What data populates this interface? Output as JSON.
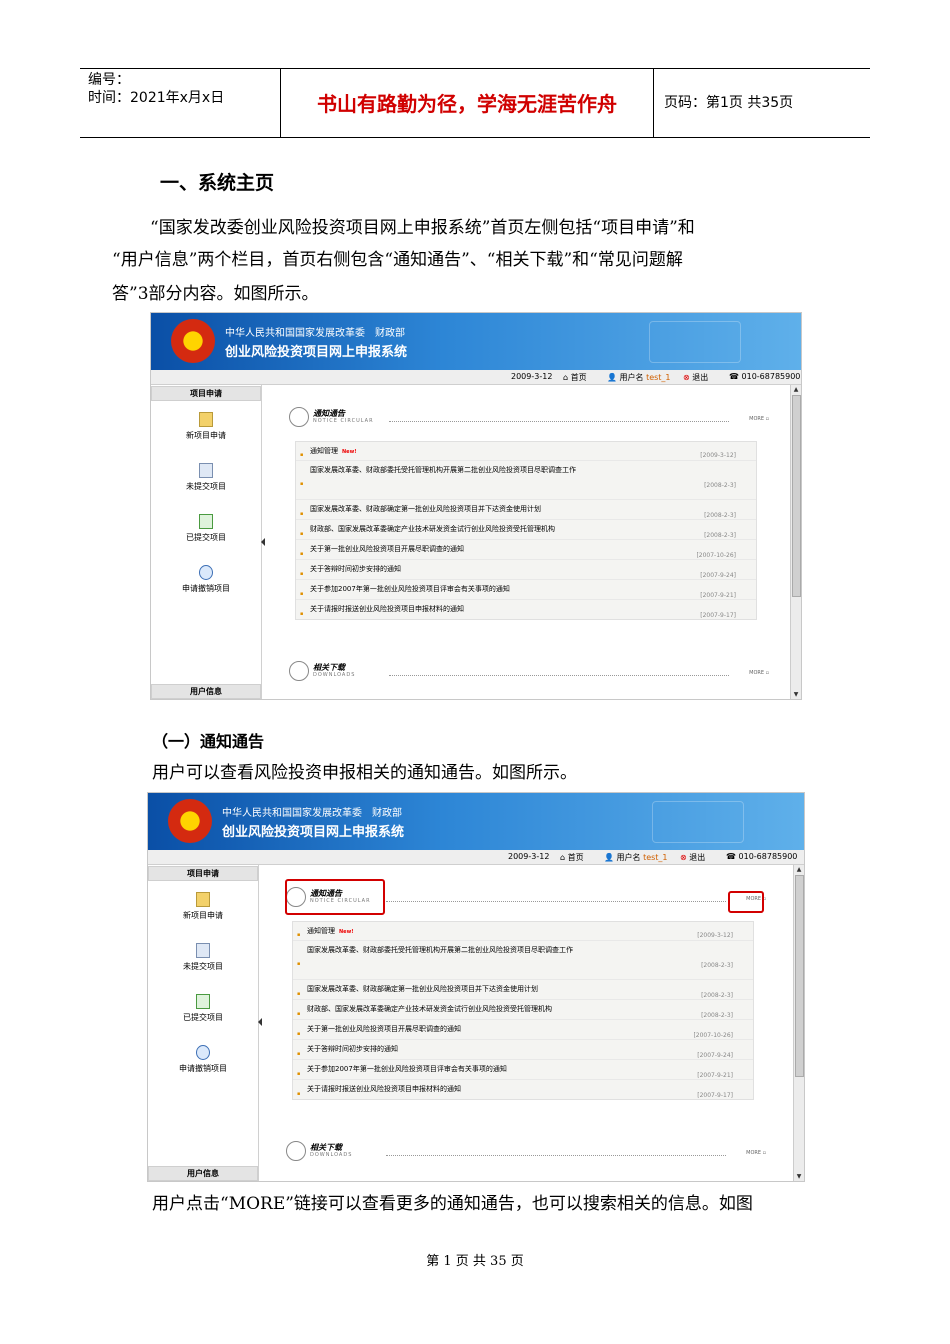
{
  "header": {
    "number_label": "编号：",
    "time_label": "时间：2021年x月x日",
    "motto": "书山有路勤为径，学海无涯苦作舟",
    "page_info": "页码：第1页 共35页"
  },
  "section1_title": "一、系统主页",
  "para1": {
    "line1": "“国家发改委创业风险投资项目网上申报系统”首页左侧包括“项目申请”和",
    "line2": "“用户信息”两个栏目，首页右侧包含“通知通告”、“相关下载”和“常见问题解",
    "line3": "答”3部分内容。如图所示。"
  },
  "subsection1_title": "（一）通知通告",
  "para2": "用户可以查看风险投资申报相关的通知通告。如图所示。",
  "para3": "用户点击“MORE”链接可以查看更多的通知通告，也可以搜索相关的信息。如图",
  "footer": "第 1 页 共 35 页",
  "screenshot": {
    "banner_line1": "中华人民共和国国家发展改革委　财政部",
    "banner_line2": "创业风险投资项目网上申报系统",
    "toolbar": {
      "date": "2009-3-12",
      "home": "首页",
      "user_label": "用户名",
      "user": "test_1",
      "logout": "退出",
      "phone": "010-68785900"
    },
    "sidebar": {
      "section": "项目申请",
      "items": [
        "新项目申请",
        "未提交项目",
        "已提交项目",
        "申请撤销项目"
      ],
      "user_section": "用户信息"
    },
    "notice": {
      "title": "通知通告",
      "subtitle": "NOTICE CIRCULAR",
      "more": "MORE",
      "new_badge": "New!",
      "rows": [
        {
          "text": "通知管理",
          "date": "[2009-3-12]"
        },
        {
          "text": "国家发展改革委、财政部委托受托管理机构开展第二批创业风险投资项目尽职调查工作",
          "date": "[2008-2-3]"
        },
        {
          "text": "国家发展改革委、财政部确定第一批创业风险投资项目并下达资金使用计划",
          "date": "[2008-2-3]"
        },
        {
          "text": "财政部、国家发展改革委确定产业技术研发资金试行创业风险投资受托管理机构",
          "date": "[2008-2-3]"
        },
        {
          "text": "关于第一批创业风险投资项目开展尽职调查的通知",
          "date": "[2007-10-26]"
        },
        {
          "text": "关于答辩时间初步安排的通知",
          "date": "[2007-9-24]"
        },
        {
          "text": "关于参加2007年第一批创业风险投资项目评审会有关事项的通知",
          "date": "[2007-9-21]"
        },
        {
          "text": "关于请报时报送创业风险投资项目申报材料的通知",
          "date": "[2007-9-17]"
        }
      ]
    },
    "downloads": {
      "title": "相关下载",
      "subtitle": "DOWNLOADS",
      "more": "MORE"
    }
  }
}
